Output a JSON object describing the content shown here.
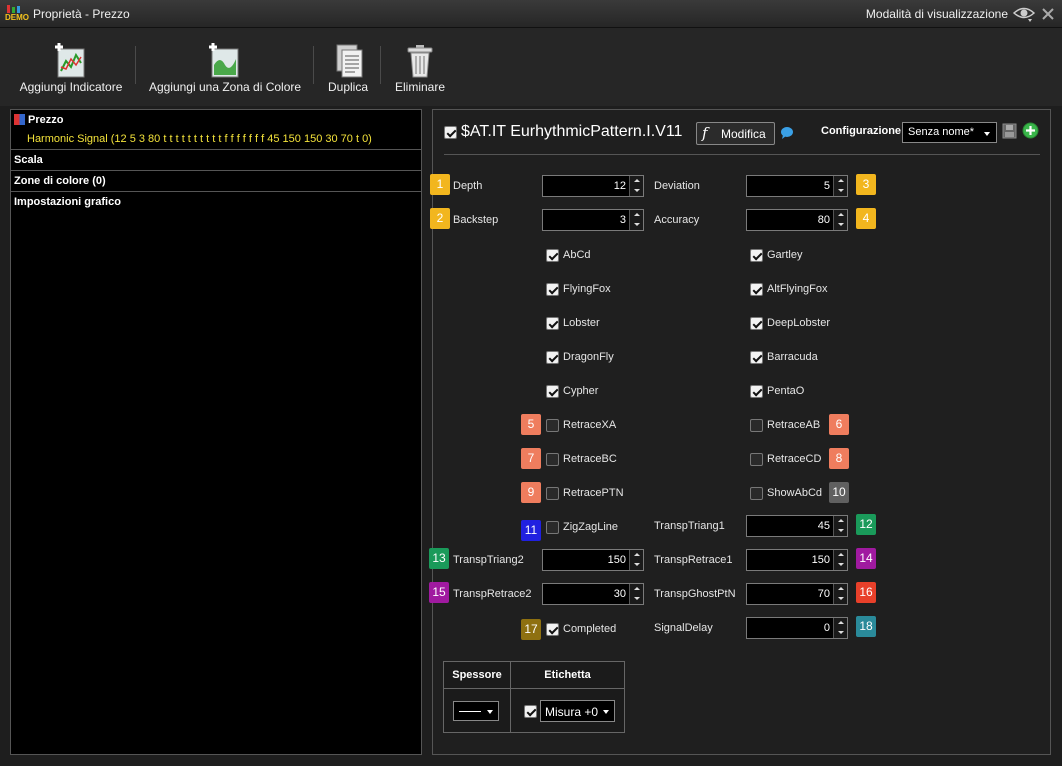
{
  "window": {
    "title": "Proprietà - Prezzo",
    "mode_label": "Modalità di visualizzazione",
    "demo_badge": "DEMO"
  },
  "toolbar": {
    "add_indicator": "Aggiungi Indicatore",
    "add_color_zone": "Aggiungi una Zona di Colore",
    "duplicate": "Duplica",
    "delete": "Eliminare"
  },
  "left": {
    "price": "Prezzo",
    "signal": "Harmonic Signal (12 5 3 80 t t t t t t t t t t f f f f f f f 45 150 150 30 70 t 0)",
    "scale": "Scala",
    "color_zones": "Zone di colore (0)",
    "chart_settings": "Impostazioni grafico"
  },
  "right": {
    "indicator_name": "$AT.IT EurhythmicPattern.I.V11",
    "modify": "Modifica",
    "config_label": "Configurazione:",
    "config_value": "Senza nome*"
  },
  "params": {
    "depth": {
      "label": "Depth",
      "value": "12",
      "badge": "1"
    },
    "backstep": {
      "label": "Backstep",
      "value": "3",
      "badge": "2"
    },
    "deviation": {
      "label": "Deviation",
      "value": "5",
      "badge": "3"
    },
    "accuracy": {
      "label": "Accuracy",
      "value": "80",
      "badge": "4"
    },
    "transp_triang1": {
      "label": "TranspTriang1",
      "value": "45",
      "badge": "12"
    },
    "transp_triang2": {
      "label": "TranspTriang2",
      "value": "150",
      "badge": "13"
    },
    "transp_retrace1": {
      "label": "TranspRetrace1",
      "value": "150",
      "badge": "14"
    },
    "transp_retrace2": {
      "label": "TranspRetrace2",
      "value": "30",
      "badge": "15"
    },
    "transp_ghost": {
      "label": "TranspGhostPtN",
      "value": "70",
      "badge": "16"
    },
    "signal_delay": {
      "label": "SignalDelay",
      "value": "0",
      "badge": "18"
    }
  },
  "checks": {
    "abcd": "AbCd",
    "gartley": "Gartley",
    "flyingfox": "FlyingFox",
    "altflyingfox": "AltFlyingFox",
    "lobster": "Lobster",
    "deeplobster": "DeepLobster",
    "dragonfly": "DragonFly",
    "barracuda": "Barracuda",
    "cypher": "Cypher",
    "pentao": "PentaO",
    "retracexa": "RetraceXA",
    "retraceab": "RetraceAB",
    "retracebc": "RetraceBC",
    "retracecd": "RetraceCD",
    "retraceptn": "RetracePTN",
    "showabcd": "ShowAbCd",
    "zigzag": "ZigZagLine",
    "completed": "Completed"
  },
  "check_badges": {
    "retracexa": "5",
    "retraceab": "6",
    "retracebc": "7",
    "retracecd": "8",
    "retraceptn": "9",
    "showabcd": "10",
    "zigzag": "11",
    "completed": "17"
  },
  "bottom": {
    "thickness_header": "Spessore",
    "label_header": "Etichetta",
    "label_value": "Misura +0"
  },
  "colors": {
    "yellow": "#f2b61e",
    "salmon": "#ef7d5e",
    "blue": "#2020e0",
    "green": "#1a9a5a",
    "purple": "#a01aa0",
    "red": "#e8402a",
    "gold": "#8e7010",
    "teal": "#2a8a9a",
    "gray": "#606060"
  }
}
